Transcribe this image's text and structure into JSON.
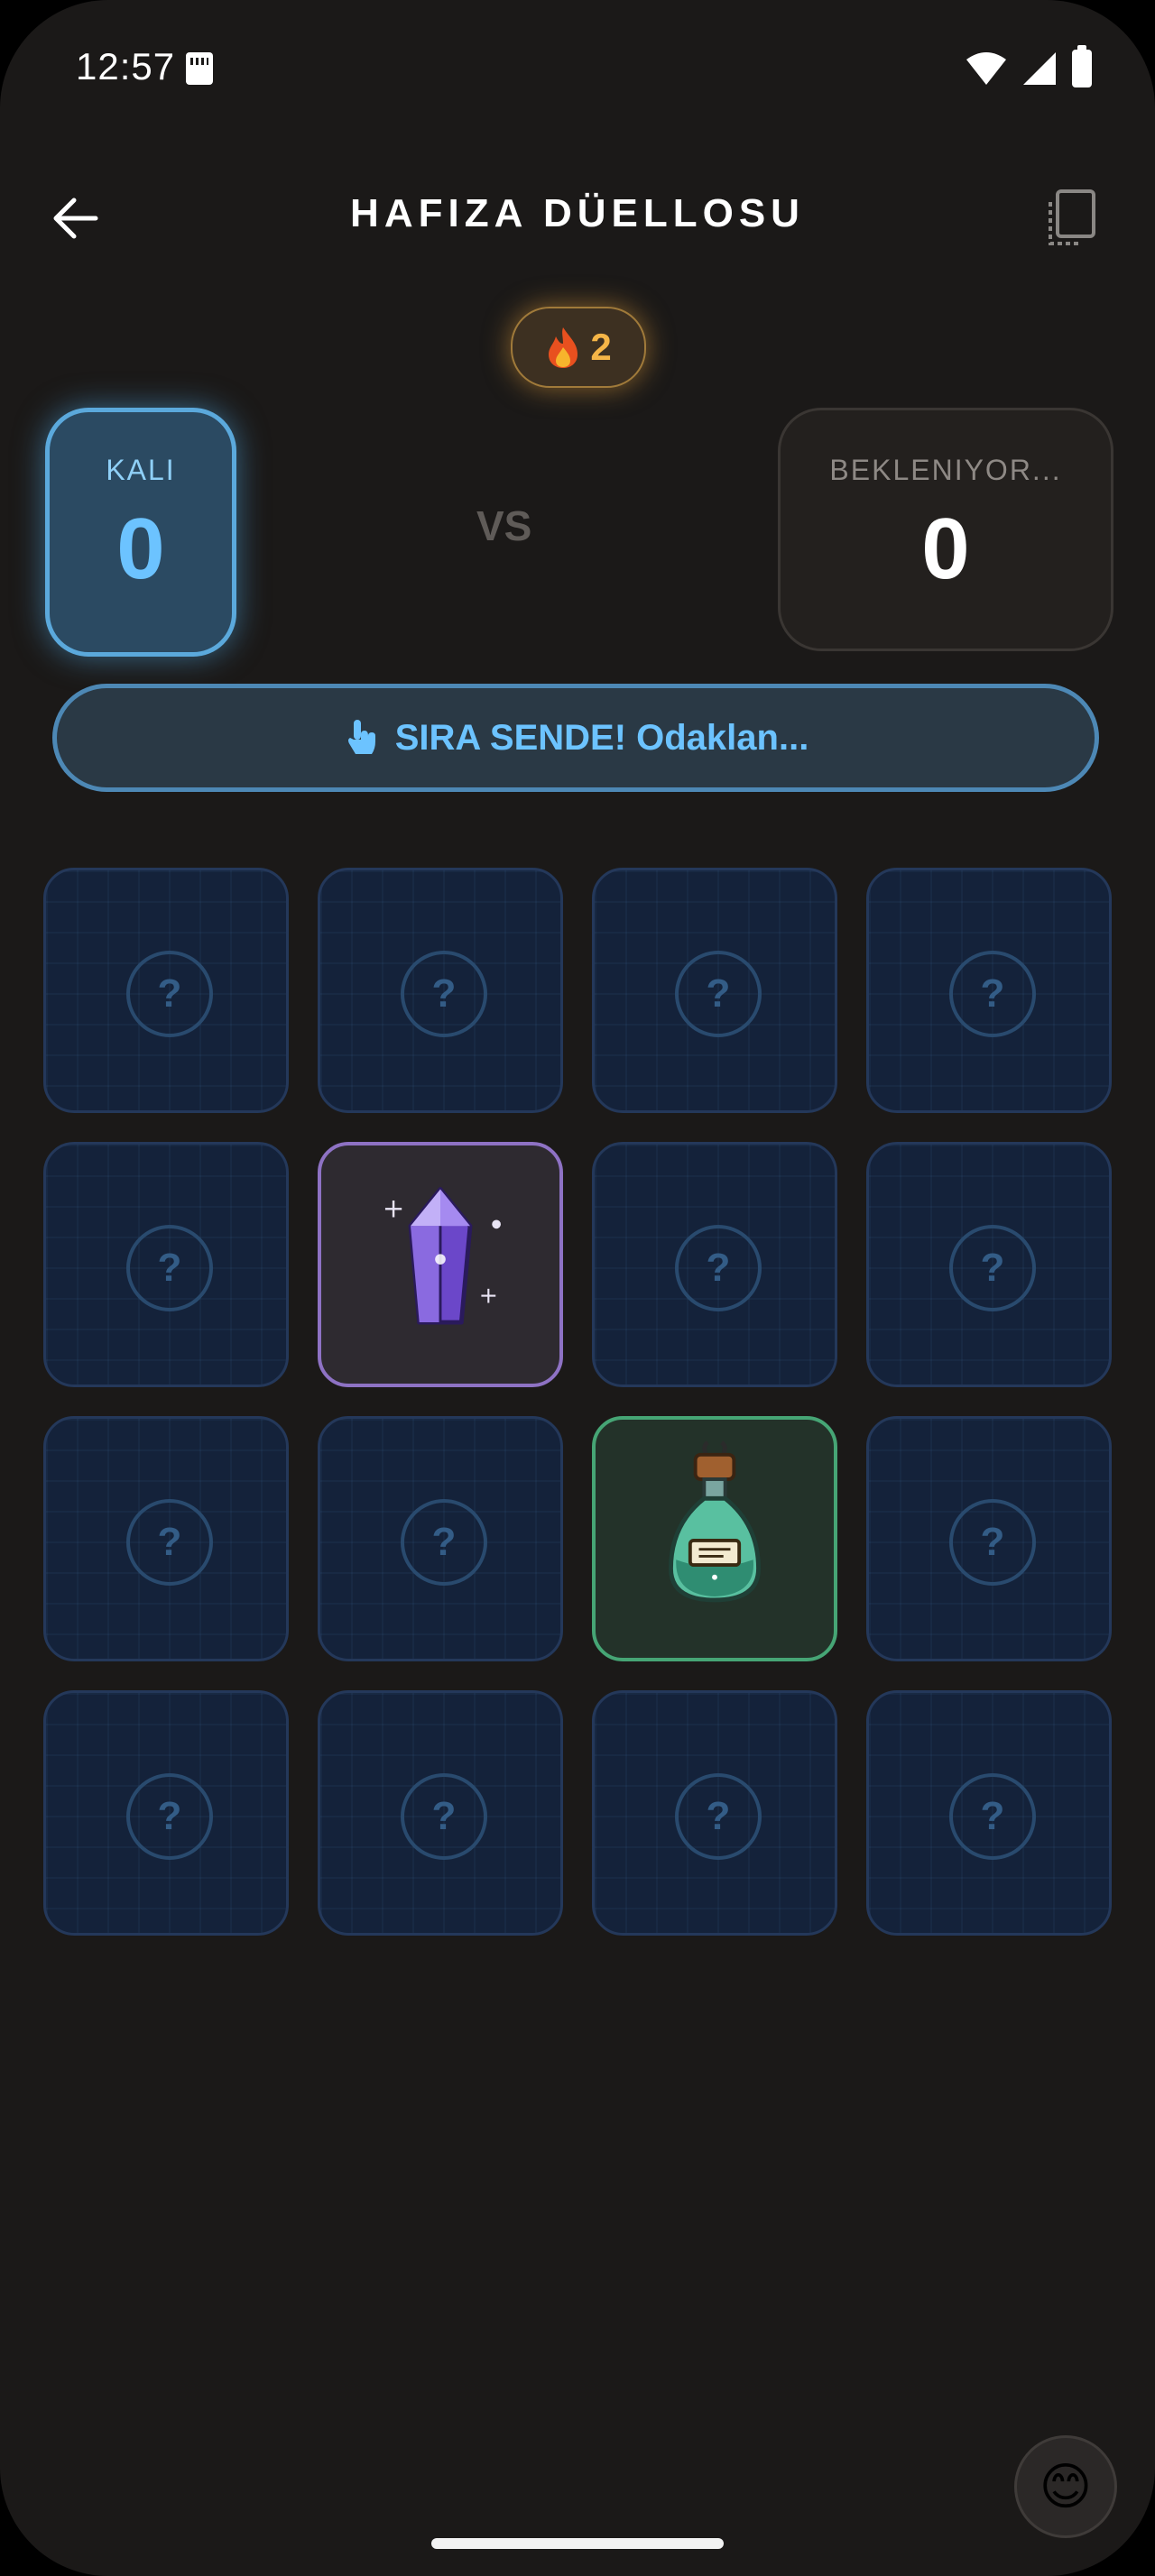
{
  "status_bar": {
    "time": "12:57"
  },
  "header": {
    "title": "HAFIZA DÜELLOSU"
  },
  "streak": {
    "count": "2",
    "icon": "flame-icon"
  },
  "players": {
    "you": {
      "name": "KALI",
      "score": "0"
    },
    "opponent": {
      "name": "BEKLENIYOR...",
      "score": "0"
    },
    "vs": "VS"
  },
  "turn_banner": {
    "text": "SIRA SENDE! Odaklan...",
    "icon": "pointing-hand-icon"
  },
  "grid": {
    "rows": 4,
    "cols": 4,
    "cards": [
      {
        "state": "hidden",
        "glyph": "?"
      },
      {
        "state": "hidden",
        "glyph": "?"
      },
      {
        "state": "hidden",
        "glyph": "?"
      },
      {
        "state": "hidden",
        "glyph": "?"
      },
      {
        "state": "hidden",
        "glyph": "?"
      },
      {
        "state": "revealed",
        "item": "crystal"
      },
      {
        "state": "hidden",
        "glyph": "?"
      },
      {
        "state": "hidden",
        "glyph": "?"
      },
      {
        "state": "hidden",
        "glyph": "?"
      },
      {
        "state": "hidden",
        "glyph": "?"
      },
      {
        "state": "revealed",
        "item": "potion"
      },
      {
        "state": "hidden",
        "glyph": "?"
      },
      {
        "state": "hidden",
        "glyph": "?"
      },
      {
        "state": "hidden",
        "glyph": "?"
      },
      {
        "state": "hidden",
        "glyph": "?"
      },
      {
        "state": "hidden",
        "glyph": "?"
      }
    ]
  },
  "emoji_button": {
    "glyph": "😊"
  },
  "colors": {
    "background": "#1b1918",
    "accent_blue": "#6cc3ff",
    "streak_gold": "#f5b547",
    "crystal_border": "#8e72c4",
    "potion_border": "#46a575"
  }
}
